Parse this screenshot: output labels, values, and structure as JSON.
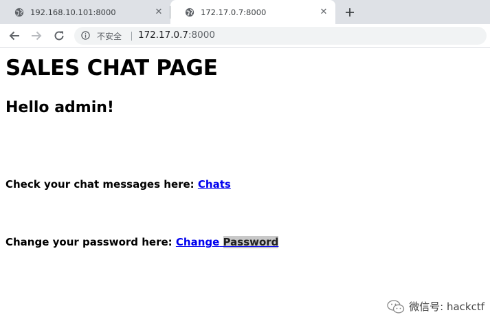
{
  "tabs": [
    {
      "title": "192.168.10.101:8000"
    },
    {
      "title": "172.17.0.7:8000"
    }
  ],
  "toolbar": {
    "security_text": "不安全",
    "url_host": "172.17.0.7",
    "url_port": ":8000"
  },
  "page": {
    "heading": "SALES CHAT PAGE",
    "greeting": "Hello admin!",
    "chat_prompt": "Check your chat messages here:",
    "chat_link": "Chats",
    "password_prompt": "Change your password here:",
    "password_link_part1": "Change",
    "password_link_part2": "Password"
  },
  "watermark": {
    "text": "微信号: hackctf"
  }
}
